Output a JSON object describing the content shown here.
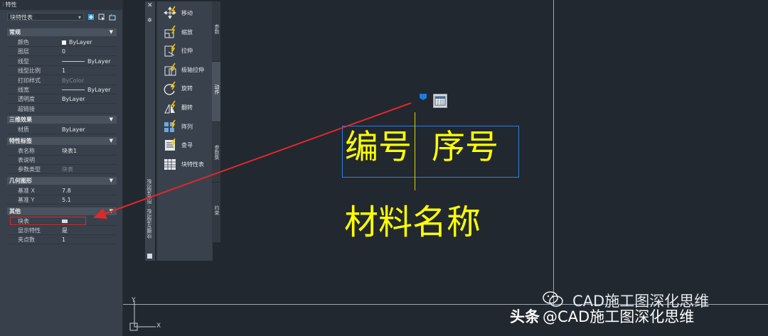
{
  "panel": {
    "title": "特性",
    "selector": "块特性表",
    "sections": [
      {
        "label": "常规",
        "rows": [
          {
            "k": "颜色",
            "v": "ByLayer",
            "style": "swatch"
          },
          {
            "k": "图层",
            "v": "0"
          },
          {
            "k": "线型",
            "v": "ByLayer",
            "style": "line"
          },
          {
            "k": "线型比例",
            "v": "1"
          },
          {
            "k": "打印样式",
            "v": "ByColor",
            "style": "dim"
          },
          {
            "k": "线宽",
            "v": "ByLayer",
            "style": "line"
          },
          {
            "k": "透明度",
            "v": "ByLayer"
          },
          {
            "k": "超链接",
            "v": ""
          }
        ]
      },
      {
        "label": "三维效果",
        "rows": [
          {
            "k": "材质",
            "v": "ByLayer"
          }
        ]
      },
      {
        "label": "特性标签",
        "rows": [
          {
            "k": "表名称",
            "v": "块表1"
          },
          {
            "k": "表说明",
            "v": ""
          },
          {
            "k": "参数类型",
            "v": "块表",
            "style": "dim"
          }
        ]
      },
      {
        "label": "几何图形",
        "rows": [
          {
            "k": "基准 X",
            "v": "7.8"
          },
          {
            "k": "基准 Y",
            "v": "5.1"
          }
        ]
      },
      {
        "label": "其他",
        "rows": [
          {
            "k": "块表",
            "v": "",
            "style": "table"
          },
          {
            "k": "显示特性",
            "v": "是"
          },
          {
            "k": "夹点数",
            "v": "1"
          }
        ]
      }
    ]
  },
  "palette": {
    "title": "块编写选项板 - 所有选项板",
    "tools": [
      {
        "label": "移动",
        "icon": "move-icon"
      },
      {
        "label": "缩放",
        "icon": "scale-icon"
      },
      {
        "label": "拉伸",
        "icon": "stretch-icon"
      },
      {
        "label": "极轴拉伸",
        "icon": "polar-stretch-icon"
      },
      {
        "label": "旋转",
        "icon": "rotate-icon"
      },
      {
        "label": "翻转",
        "icon": "flip-icon"
      },
      {
        "label": "阵列",
        "icon": "array-icon"
      },
      {
        "label": "查寻",
        "icon": "lookup-icon"
      },
      {
        "label": "块特性表",
        "icon": "block-table-icon"
      }
    ],
    "tabs": [
      {
        "label": "参数",
        "active": false
      },
      {
        "label": "动作",
        "active": true
      },
      {
        "label": "参数集",
        "active": false
      },
      {
        "label": "约束",
        "active": false
      }
    ]
  },
  "drawing": {
    "text_top_left": "编号",
    "text_top_right": "序号",
    "text_bottom": "材料名称",
    "text_color": "#ffff00",
    "selection_color": "#2f7fe0",
    "arrow_color": "#e02828"
  },
  "ucs": {
    "x": "X",
    "y": "Y"
  },
  "watermark": {
    "line1": "CAD施工图深化思维",
    "prefix": "头条",
    "line2": "@CAD施工图深化思维"
  }
}
